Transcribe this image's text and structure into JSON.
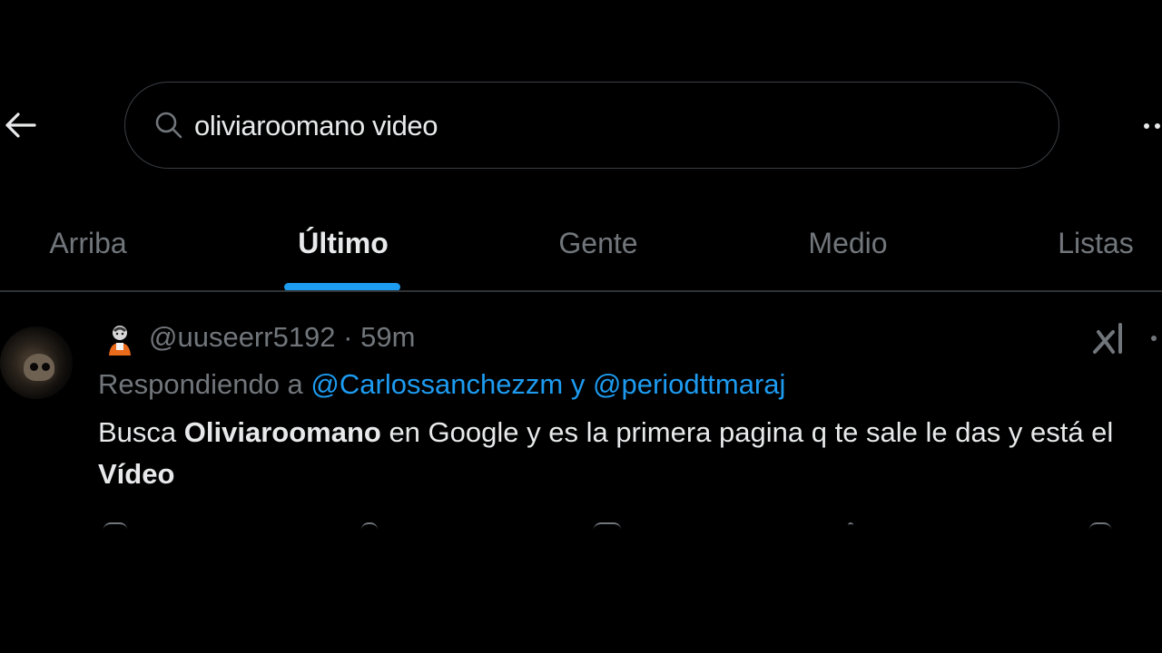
{
  "header": {
    "back_icon": "arrow-left-icon",
    "search": {
      "icon": "search-icon",
      "value": "oliviaroomano video"
    },
    "more_icon": "more-dots-icon"
  },
  "tabs": [
    {
      "label": "Arriba",
      "active": false
    },
    {
      "label": "Último",
      "active": true
    },
    {
      "label": "Gente",
      "active": false
    },
    {
      "label": "Medio",
      "active": false
    },
    {
      "label": "Listas",
      "active": false
    }
  ],
  "accent_color": "#1d9bf0",
  "tweet": {
    "name_emoji": "🧟",
    "handle": "@uuseerr5192",
    "separator": " · ",
    "time": "59m",
    "replying_prefix": "Respondiendo a ",
    "mention_1": "@Carlossanchezzm",
    "mention_joiner": " y ",
    "mention_2": "@periodttmaraj",
    "text_1": "Busca ",
    "text_bold_1": "Oliviaroomano",
    "text_2": " en Google y es la primera pagina q te sale le das y está el ",
    "text_bold_2": "Vídeo",
    "grok_icon": "grok-icon"
  }
}
